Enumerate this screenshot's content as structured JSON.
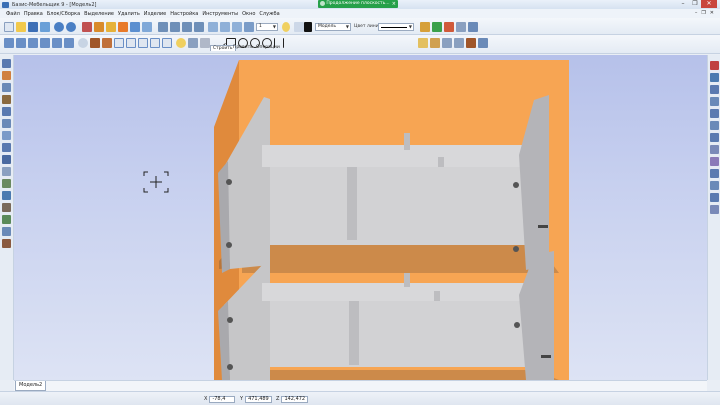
{
  "window": {
    "title": "Базис-Мебельщик 9 - [Модель2]",
    "minimize": "–",
    "maximize": "❐",
    "close": "✕"
  },
  "notice": {
    "text": "Продолжение плоскость...",
    "close": "×"
  },
  "menu": {
    "items": [
      "Файл",
      "Правка",
      "Блок/Сборка",
      "Выделение",
      "Удалить",
      "Изделие",
      "Настройка",
      "Инструменты",
      "Окно",
      "Служба"
    ],
    "mdi_controls": [
      "–",
      "❐",
      "✕"
    ]
  },
  "toolbar": {
    "layer_value": "1",
    "mode_value": "Модель",
    "line_color_label": "Цвет линии",
    "panel_tabs": [
      "Строить",
      "Править",
      "Операции"
    ]
  },
  "viewport": {
    "cursor_icon": "crosshair-cursor-icon",
    "colors": {
      "background_top": "#b6c1ea",
      "board": "#f7a553",
      "board_dark": "#e08a3c",
      "shelf": "#cc8a4a",
      "drawer_metal": "#c6c6c8"
    }
  },
  "model_tab": {
    "label": "Модель2"
  },
  "status": {
    "x_label": "X",
    "x_value": "-78,4",
    "y_label": "Y",
    "y_value": "471,489",
    "z_label": "Z",
    "z_value": "142,472"
  }
}
